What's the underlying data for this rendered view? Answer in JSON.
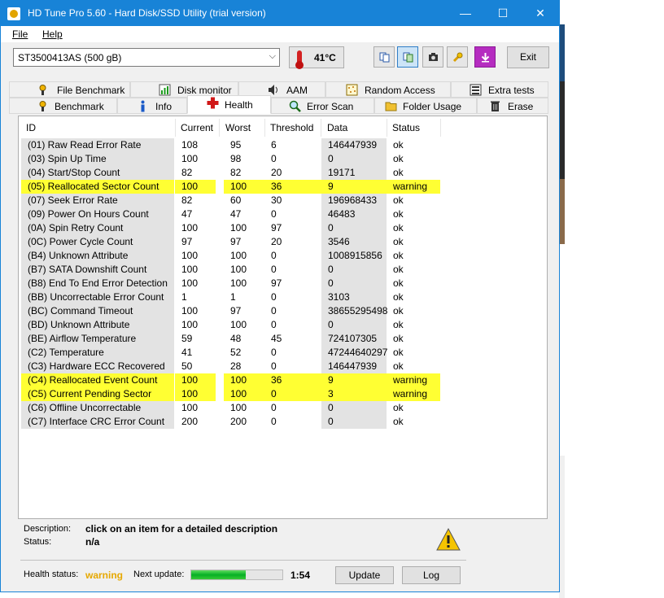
{
  "window": {
    "title": "HD Tune Pro 5.60 - Hard Disk/SSD Utility (trial version)",
    "minimize": "—",
    "maximize": "☐",
    "close": "✕"
  },
  "menu": {
    "file": "File",
    "help": "Help"
  },
  "toolbar": {
    "drive": "ST3500413AS (500 gB)",
    "temperature": "41°C",
    "exit": "Exit"
  },
  "tabs_top": [
    {
      "label": "File Benchmark",
      "icon": "file-benchmark-icon"
    },
    {
      "label": "Disk monitor",
      "icon": "disk-monitor-icon"
    },
    {
      "label": "AAM",
      "icon": "speaker-icon"
    },
    {
      "label": "Random Access",
      "icon": "random-access-icon"
    },
    {
      "label": "Extra tests",
      "icon": "extra-tests-icon"
    }
  ],
  "tabs_bottom": [
    {
      "label": "Benchmark",
      "icon": "benchmark-icon"
    },
    {
      "label": "Info",
      "icon": "info-icon"
    },
    {
      "label": "Health",
      "icon": "health-cross-icon"
    },
    {
      "label": "Error Scan",
      "icon": "magnifier-icon"
    },
    {
      "label": "Folder Usage",
      "icon": "folder-icon"
    },
    {
      "label": "Erase",
      "icon": "trash-icon"
    }
  ],
  "table": {
    "columns": [
      "ID",
      "Current",
      "Worst",
      "Threshold",
      "Data",
      "Status"
    ],
    "rows": [
      {
        "id": "(01) Raw Read Error Rate",
        "current": "108",
        "worst": "95",
        "threshold": "6",
        "data": "146447939",
        "status": "ok",
        "warn": false
      },
      {
        "id": "(03) Spin Up Time",
        "current": "100",
        "worst": "98",
        "threshold": "0",
        "data": "0",
        "status": "ok",
        "warn": false
      },
      {
        "id": "(04) Start/Stop Count",
        "current": "82",
        "worst": "82",
        "threshold": "20",
        "data": "19171",
        "status": "ok",
        "warn": false
      },
      {
        "id": "(05) Reallocated Sector Count",
        "current": "100",
        "worst": "100",
        "threshold": "36",
        "data": "9",
        "status": "warning",
        "warn": true
      },
      {
        "id": "(07) Seek Error Rate",
        "current": "82",
        "worst": "60",
        "threshold": "30",
        "data": "196968433",
        "status": "ok",
        "warn": false
      },
      {
        "id": "(09) Power On Hours Count",
        "current": "47",
        "worst": "47",
        "threshold": "0",
        "data": "46483",
        "status": "ok",
        "warn": false
      },
      {
        "id": "(0A) Spin Retry Count",
        "current": "100",
        "worst": "100",
        "threshold": "97",
        "data": "0",
        "status": "ok",
        "warn": false
      },
      {
        "id": "(0C) Power Cycle Count",
        "current": "97",
        "worst": "97",
        "threshold": "20",
        "data": "3546",
        "status": "ok",
        "warn": false
      },
      {
        "id": "(B4) Unknown Attribute",
        "current": "100",
        "worst": "100",
        "threshold": "0",
        "data": "1008915856",
        "status": "ok",
        "warn": false
      },
      {
        "id": "(B7) SATA Downshift Count",
        "current": "100",
        "worst": "100",
        "threshold": "0",
        "data": "0",
        "status": "ok",
        "warn": false
      },
      {
        "id": "(B8) End To End Error Detection",
        "current": "100",
        "worst": "100",
        "threshold": "97",
        "data": "0",
        "status": "ok",
        "warn": false
      },
      {
        "id": "(BB) Uncorrectable Error Count",
        "current": "1",
        "worst": "1",
        "threshold": "0",
        "data": "3103",
        "status": "ok",
        "warn": false
      },
      {
        "id": "(BC) Command Timeout",
        "current": "100",
        "worst": "97",
        "threshold": "0",
        "data": "38655295498",
        "status": "ok",
        "warn": false
      },
      {
        "id": "(BD) Unknown Attribute",
        "current": "100",
        "worst": "100",
        "threshold": "0",
        "data": "0",
        "status": "ok",
        "warn": false
      },
      {
        "id": "(BE) Airflow Temperature",
        "current": "59",
        "worst": "48",
        "threshold": "45",
        "data": "724107305",
        "status": "ok",
        "warn": false
      },
      {
        "id": "(C2) Temperature",
        "current": "41",
        "worst": "52",
        "threshold": "0",
        "data": "47244640297",
        "status": "ok",
        "warn": false
      },
      {
        "id": "(C3) Hardware ECC Recovered",
        "current": "50",
        "worst": "28",
        "threshold": "0",
        "data": "146447939",
        "status": "ok",
        "warn": false
      },
      {
        "id": "(C4) Reallocated Event Count",
        "current": "100",
        "worst": "100",
        "threshold": "36",
        "data": "9",
        "status": "warning",
        "warn": true
      },
      {
        "id": "(C5) Current Pending Sector",
        "current": "100",
        "worst": "100",
        "threshold": "0",
        "data": "3",
        "status": "warning",
        "warn": true
      },
      {
        "id": "(C6) Offline Uncorrectable",
        "current": "100",
        "worst": "100",
        "threshold": "0",
        "data": "0",
        "status": "ok",
        "warn": false
      },
      {
        "id": "(C7) Interface CRC Error Count",
        "current": "200",
        "worst": "200",
        "threshold": "0",
        "data": "0",
        "status": "ok",
        "warn": false
      }
    ]
  },
  "description": {
    "description_label": "Description:",
    "description_value": "click on an item for a detailed description",
    "status_label": "Status:",
    "status_value": "n/a"
  },
  "statusbar": {
    "health_label": "Health status:",
    "health_value": "warning",
    "next_update_label": "Next update:",
    "next_update_progress": 0.6,
    "time": "1:54",
    "update": "Update",
    "log": "Log"
  },
  "colors": {
    "titlebar": "#1883d7",
    "warning_row": "#ffff33",
    "health_warning_text": "#e6a800",
    "progress": "#06b025"
  }
}
